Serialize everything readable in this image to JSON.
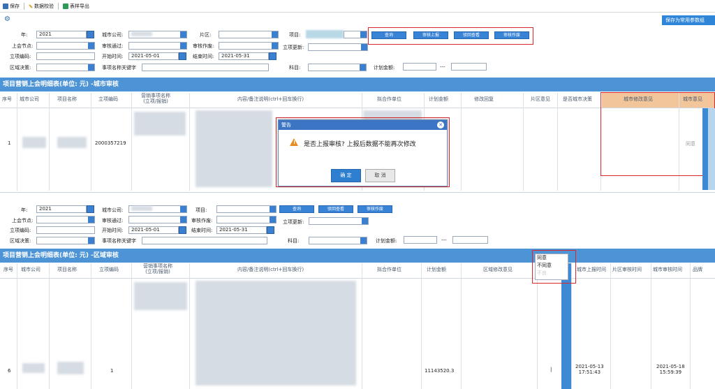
{
  "toolbar": {
    "save": "保存",
    "validate": "数据校验",
    "export": "表样导出"
  },
  "save_common": "保存为常用参数组",
  "form1": {
    "year_label": "年:",
    "year": "2021",
    "city_label": "城市公司:",
    "area_label": "片区:",
    "project_label": "项目:",
    "node_label": "上会节点:",
    "audit_pass_label": "审核通过:",
    "audit_void_label": "审核作废:",
    "update_label": "立项更新:",
    "code_label": "立项编码:",
    "start_label": "开始时间:",
    "start": "2021-05-01",
    "end_label": "结束时间:",
    "end": "2021-05-31",
    "region_label": "区域决策:",
    "keyword_label": "事项名称关键字",
    "subject_label": "科目:",
    "plan_label": "计划金额:",
    "dash": "---"
  },
  "buttons1": {
    "query": "查询",
    "report": "审核上报",
    "reject": "驳回查看",
    "void": "审核作废"
  },
  "section1": "项目营销上会明细表(单位: 元) -城市审核",
  "headers1": [
    "序号",
    "城市公司",
    "项目名称",
    "立项编码",
    "营销事项名称\n(立项/报销)",
    "内容/备注说明(ctrl+回车换行)",
    "拟合作单位",
    "计划金额",
    "修改回复",
    "片区意见",
    "是否城市决策",
    "城市修改意见",
    "城市意见"
  ],
  "row1": {
    "idx": "1",
    "code": "2000357219",
    "opinion": "同意"
  },
  "dialog": {
    "title": "警告",
    "message": "是否上报审核? 上报后数据不能再次修改",
    "ok": "确 定",
    "cancel": "取 消"
  },
  "form2": {
    "year_label": "年:",
    "year": "2021",
    "city_label": "城市公司:",
    "project_label": "项目:",
    "node_label": "上会节点:",
    "audit_pass_label": "审核通过:",
    "audit_void_label": "审核作废:",
    "update_label": "立项更新:",
    "code_label": "立项编码:",
    "start_label": "开始时间:",
    "start": "2021-05-01",
    "end_label": "结束时间:",
    "end": "2021-05-31",
    "region_label": "区域决策:",
    "keyword_label": "事项名称关键字",
    "subject_label": "科目:",
    "plan_label": "计划金额:",
    "dash": "---"
  },
  "buttons2": {
    "query": "查询",
    "reject": "驳回查看",
    "void": "审核作废"
  },
  "section2": "项目营销上会明细表(单位: 元) -区域审核",
  "headers2": [
    "序号",
    "城市公司",
    "项目名称",
    "立项编码",
    "营销事项名称\n(立项/报销)",
    "内容/备注说明(ctrl+回车换行)",
    "拟合作单位",
    "计划金额",
    "区域修改意见",
    "城市上报时间",
    "片区审核时间",
    "城市审核时间",
    "品牌"
  ],
  "row2": {
    "idx": "6",
    "num": "1",
    "amount": "11143520.3",
    "bar": "|",
    "t1": "2021-05-13\n17:51:43",
    "t2": "2021-05-18\n15:59:39"
  },
  "menu_items": [
    "同意",
    "不同意",
    "不良"
  ]
}
